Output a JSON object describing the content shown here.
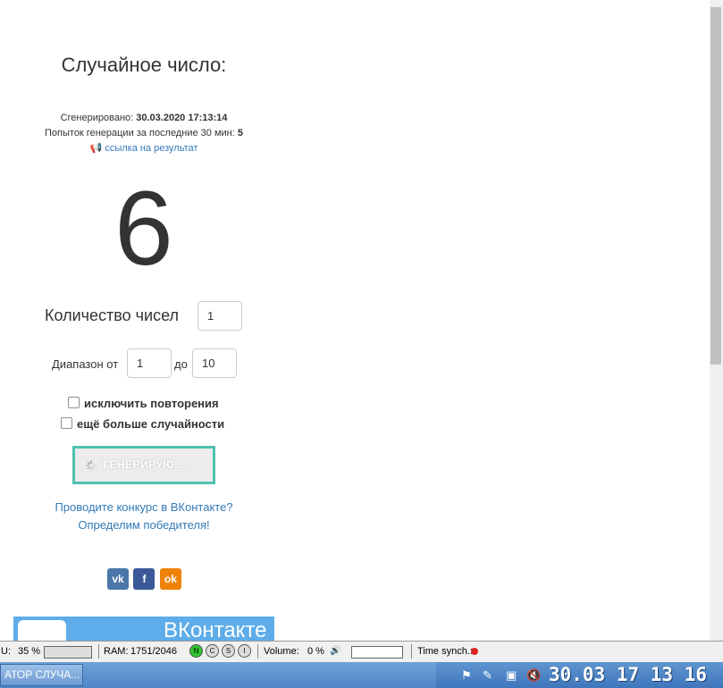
{
  "main": {
    "title": "Случайное число:",
    "generated_label": "Сгенерировано:",
    "generated_value": "30.03.2020 17:13:14",
    "attempts_label": "Попыток генерации за последние 30 мин:",
    "attempts_value": "5",
    "result_link": "ссылка на результат",
    "result_number": "6",
    "count_label": "Количество чисел",
    "count_value": "1",
    "range_from_label": "Диапазон от",
    "range_from_value": "1",
    "range_to_label": "до",
    "range_to_value": "10",
    "exclude_repeats_label": "исключить повторения",
    "more_random_label": "ещё больше случайности",
    "generate_button_label": "ГЕНЕРИРУЮ...",
    "contest_line1": "Проводите конкурс в ВКонтакте?",
    "contest_line2": "Определим победителя!",
    "social": {
      "vk": "vk",
      "fb": "f",
      "ok": "ok"
    },
    "vk_banner_text": "ВКонтакте"
  },
  "sysbar": {
    "cpu_label": "U:",
    "cpu_value": "35 %",
    "ram_label": "RAM:",
    "ram_value": "1751/2046",
    "mode_n": "N",
    "mode_c": "C",
    "mode_s": "S",
    "mode_i": "I",
    "volume_label": "Volume:",
    "volume_value": "0 %",
    "time_synch_label": "Time synch.:"
  },
  "taskbar": {
    "task_label": "АТОР СЛУЧА...",
    "clock": "30.03 17 13 16"
  },
  "colors": {
    "link": "#337ab7",
    "button_border": "#4fc1b0",
    "vk": "#4a76a8",
    "fb": "#3b5998",
    "ok": "#ee8208",
    "taskbar": "#4f86c7"
  }
}
